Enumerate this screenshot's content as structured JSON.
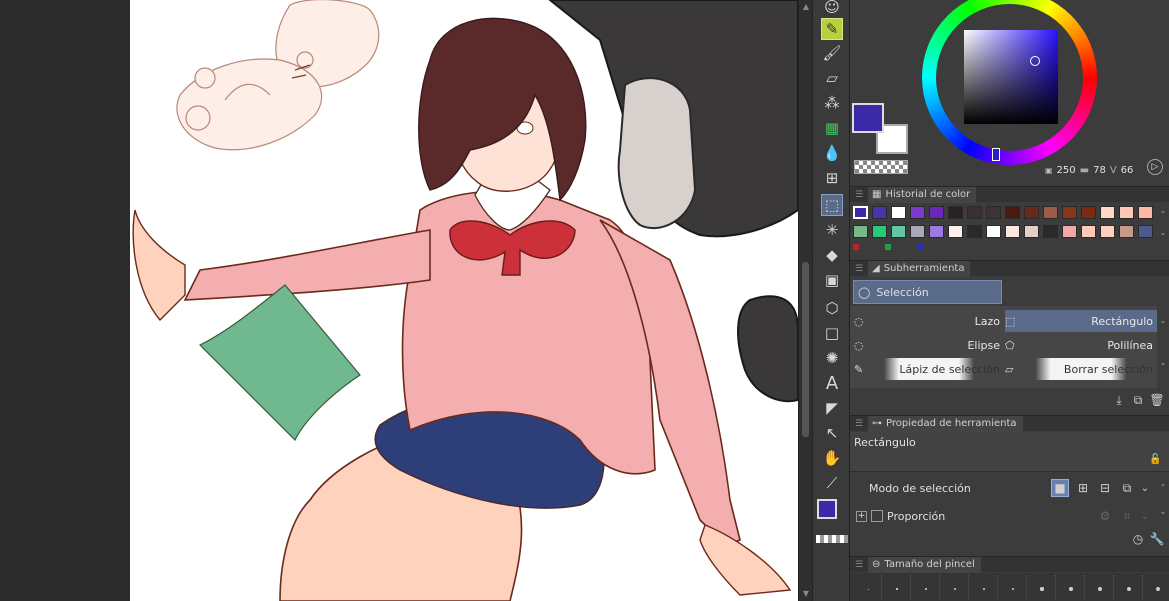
{
  "color": {
    "main_color": "#3a2aa8",
    "sub_color": "#ffffff",
    "hsv_h": "250",
    "hsv_s": "78",
    "hsv_v": "66"
  },
  "color_history": {
    "title": "Historial de color",
    "row1": [
      "#3a2aa8",
      "#4a32b0",
      "#ffffff",
      "#7a3ad0",
      "#6a28b8",
      "#2a2222",
      "#3a3030",
      "#3c3434",
      "#4a1a10",
      "#6a2818",
      "#a05a48",
      "#8a3418",
      "#7a2a10",
      "#ffd8c8",
      "#ffc8b8",
      "#ffb8a8"
    ],
    "row2": [
      "#78b888",
      "#28c878",
      "#60c8a0",
      "#a8a8b8",
      "#9a7ae0",
      "#fff0ea",
      "#2a2a2a",
      "#ffffff",
      "#f8e8e0",
      "#e0d0c8",
      "#2a2a2a",
      "#f0a8a8",
      "#ffc8b8",
      "#ffd0c0",
      "#c89888",
      "#4a5a8a"
    ]
  },
  "subtool": {
    "title": "Subherramienta",
    "group": "Selección",
    "items": [
      "Lazo",
      "Rectángulo",
      "Elipse",
      "Polilínea",
      "Lápiz de selección",
      "Borrar selección"
    ]
  },
  "tool_property": {
    "title": "Propiedad de herramienta",
    "tool_name": "Rectángulo",
    "selection_mode_label": "Modo de selección",
    "proportion_label": "Proporción"
  },
  "brush_size": {
    "title": "Tamaño del pincel"
  }
}
